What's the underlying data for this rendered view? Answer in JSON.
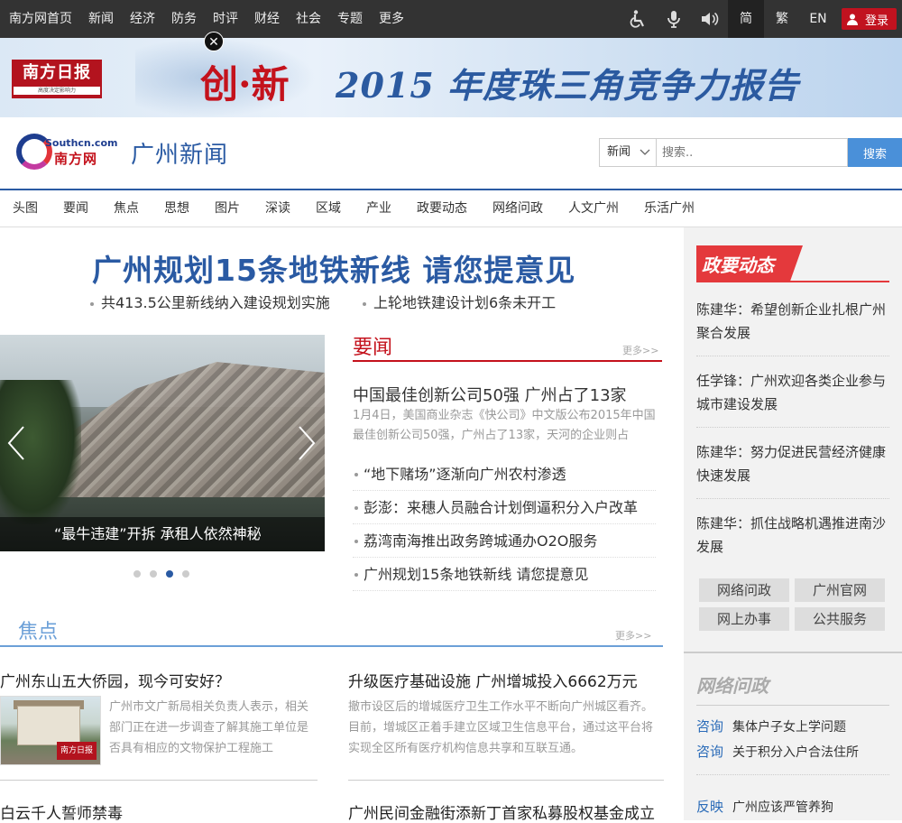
{
  "topnav": {
    "items": [
      "南方网首页",
      "新闻",
      "经济",
      "防务",
      "时评",
      "财经",
      "社会",
      "专题",
      "更多"
    ],
    "lang": [
      "简",
      "繁",
      "EN"
    ],
    "login": "登录"
  },
  "banner": {
    "paper_name": "南方日报",
    "paper_slogan": "高度决定影响力",
    "title_accent": "创·新",
    "title": "2015 年度珠三角竞争力报告"
  },
  "header": {
    "logo_en": "Southcn.com",
    "logo_cn": "南方网",
    "site_title": "广州新闻",
    "search_category": "新闻",
    "search_placeholder": "搜索..",
    "search_button": "搜索"
  },
  "mainnav": [
    "头图",
    "要闻",
    "焦点",
    "思想",
    "图片",
    "深读",
    "区域",
    "产业",
    "政要动态",
    "网络问政",
    "人文广州",
    "乐活广州"
  ],
  "headline": {
    "title": "广州规划15条地铁新线 请您提意见",
    "subs": [
      "共413.5公里新线纳入建设规划实施",
      "上轮地铁建设计划6条未开工"
    ]
  },
  "slider": {
    "caption": "“最牛违建”开拆 承租人依然神秘",
    "active_dot": 3,
    "dot_count": 4
  },
  "yaowen": {
    "title": "要闻",
    "more": "更多>>",
    "lead_title": "中国最佳创新公司50强 广州占了13家",
    "lead_summary": "1月4日，美国商业杂志《快公司》中文版公布2015年中国最佳创新公司50强，广州占了13家，天河的企业则占",
    "items": [
      "“地下赌场”逐渐向广州农村渗透",
      "彭澎：来穗人员融合计划倒逼积分入户改革",
      "荔湾南海推出政务跨城通办O2O服务",
      "广州规划15条地铁新线 请您提意见"
    ]
  },
  "jiaodian": {
    "title": "焦点",
    "more": "更多>>",
    "articles": [
      {
        "title": "广州东山五大侨园，现今可安好？",
        "summary": "广州市文广新局相关负责人表示，相关部门正在进一步调查了解其施工单位是否具有相应的文物保护工程施工"
      },
      {
        "title": "升级医疗基础设施 广州增城投入6662万元",
        "summary": "撤市设区后的增城医疗卫生工作水平不断向广州城区看齐。目前，增城区正着手建立区域卫生信息平台，通过这平台将实现全区所有医疗机构信息共享和互联互通。"
      },
      {
        "title": "白云千人誓师禁毒",
        "summary": ""
      },
      {
        "title": "广州民间金融街添新丁首家私募股权基金成立",
        "summary": ""
      }
    ],
    "thumb_stamp": "南方日报"
  },
  "sidebar": {
    "zhengyao_title": "政要动态",
    "zhengyao": [
      "陈建华：希望创新企业扎根广州聚合发展",
      "任学锋：广州欢迎各类企业参与城市建设发展",
      "陈建华：努力促进民营经济健康快速发展",
      "陈建华：抓住战略机遇推进南沙发展"
    ],
    "buttons": [
      "网络问政",
      "广州官网",
      "网上办事",
      "公共服务"
    ],
    "wenzheng_title": "网络问政",
    "wenzheng": [
      {
        "tag": "咨询",
        "text": "集体户子女上学问题"
      },
      {
        "tag": "咨询",
        "text": "关于积分入户合法住所"
      },
      {
        "tag": "反映",
        "text": "广州应该严管养狗"
      }
    ]
  },
  "colors": {
    "brand_blue": "#2a5aa3",
    "accent_red": "#c4121c",
    "topbar": "#333333"
  }
}
